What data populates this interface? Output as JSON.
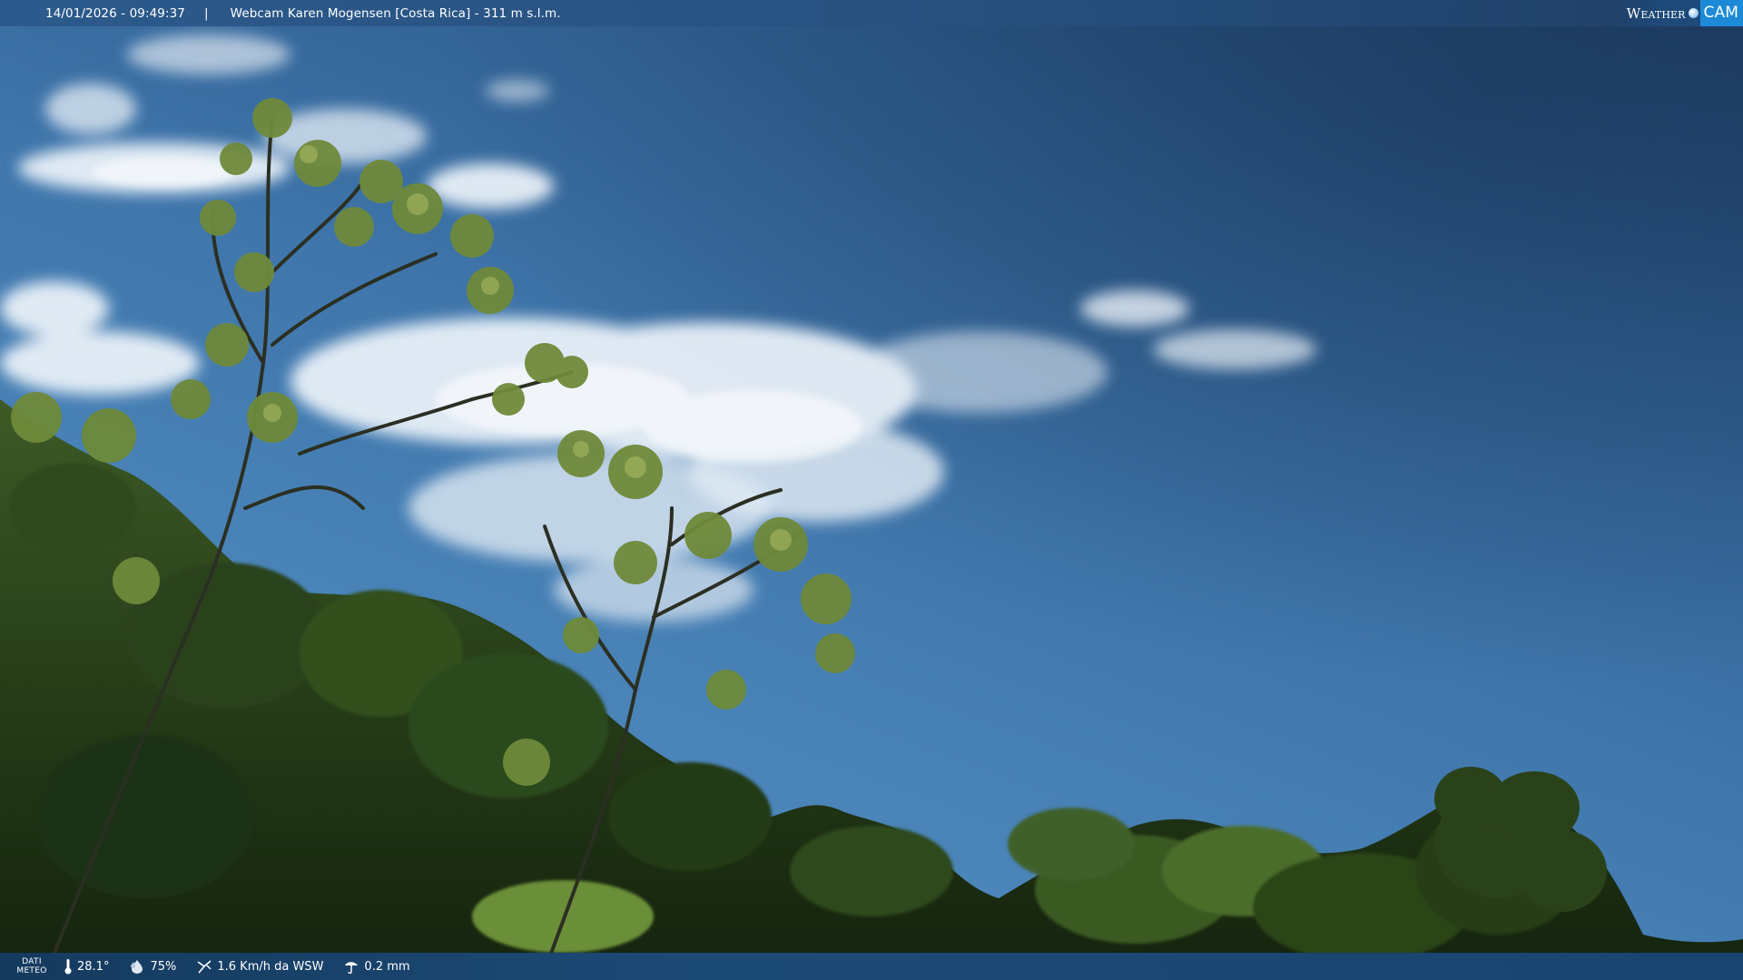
{
  "header": {
    "timestamp": "14/01/2026 - 09:49:37",
    "separator": "|",
    "title": "Webcam Karen Mogensen [Costa Rica]  - 311 m s.l.m.",
    "logo": {
      "weather": "Weather",
      "cam": "CAM"
    }
  },
  "weather_bar": {
    "label_line1": "DATI",
    "label_line2": "METEO",
    "temperature": "28.1°",
    "humidity": "75%",
    "wind": "1.6 Km/h da WSW",
    "rain": "0.2 mm"
  },
  "colors": {
    "bar_blue": "#27507f",
    "sky_dark": "#1f3e66",
    "sky_light": "#5a92c2",
    "logo_cam": "#1c8ad6",
    "foliage_dark": "#1f3318",
    "foliage_light": "#6f8f3c"
  },
  "icons": {
    "temperature": "thermometer-icon",
    "humidity": "water-drop-icon",
    "wind": "wind-icon",
    "rain": "rain-gauge-icon",
    "logo": "weathercam-logo-icon"
  }
}
